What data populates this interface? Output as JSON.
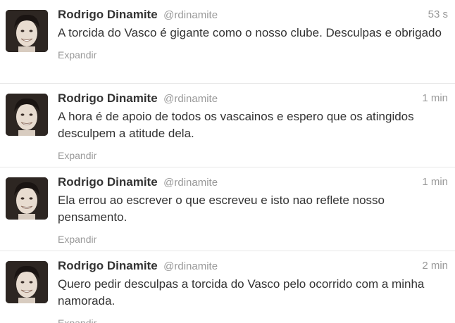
{
  "tweets": [
    {
      "fullname": "Rodrigo Dinamite",
      "username": "@rdinamite",
      "time": "53 s",
      "text": "A torcida do Vasco é gigante como o nosso clube. Desculpas e obrigado",
      "expand": "Expandir"
    },
    {
      "fullname": "Rodrigo Dinamite",
      "username": "@rdinamite",
      "time": "1 min",
      "text": "A hora é de apoio de todos os vascainos e espero que os atingidos desculpem a atitude dela.",
      "expand": "Expandir"
    },
    {
      "fullname": "Rodrigo Dinamite",
      "username": "@rdinamite",
      "time": "1 min",
      "text": "Ela errou ao escrever o que escreveu e isto nao reflete nosso pensamento.",
      "expand": "Expandir"
    },
    {
      "fullname": "Rodrigo Dinamite",
      "username": "@rdinamite",
      "time": "2 min",
      "text": "Quero pedir desculpas a torcida do Vasco pelo ocorrido com a minha namorada.",
      "expand": "Expandir"
    }
  ]
}
